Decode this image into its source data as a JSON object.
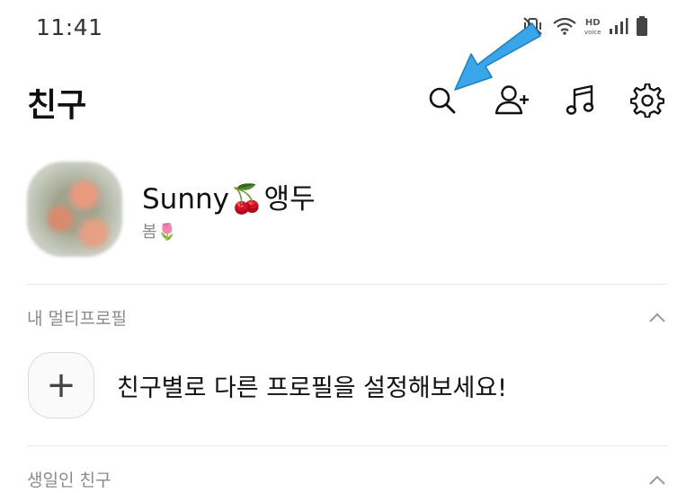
{
  "status_bar": {
    "time": "11:41",
    "hd_label": "HD",
    "voice_label": "voice",
    "icons": [
      "mute-vibrate-icon",
      "wifi-icon",
      "hd-voice-icon",
      "signal-icon",
      "battery-icon"
    ]
  },
  "header": {
    "title": "친구",
    "actions": [
      "search-icon",
      "add-friend-icon",
      "music-icon",
      "settings-icon"
    ]
  },
  "profile": {
    "name": "Sunny🍒앵두",
    "status": "봄🌷"
  },
  "multi_profile": {
    "section_title": "내 멀티프로필",
    "add_symbol": "+",
    "prompt": "친구별로 다른 프로필을 설정해보세요!"
  },
  "birthday": {
    "section_title": "생일인 친구"
  },
  "colors": {
    "annotation_arrow": "#3aa6ea",
    "text_primary": "#111111",
    "text_secondary": "#8a8a8a"
  }
}
